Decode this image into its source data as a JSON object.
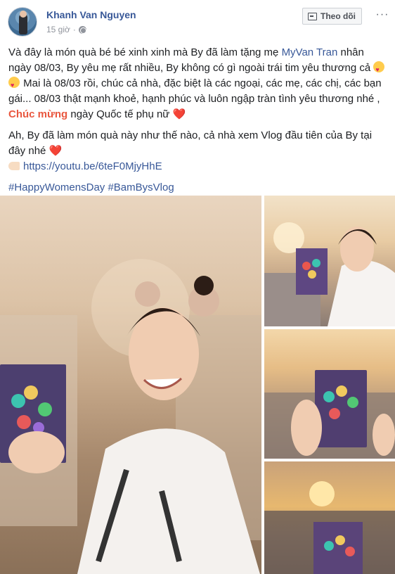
{
  "post": {
    "author": "Khanh Van Nguyen",
    "time": "15 giờ",
    "follow_label": "Theo dõi",
    "more_label": "···",
    "paragraph1": {
      "part1": "Và đây là món quà bé bé xinh xinh mà By đã làm tặng mẹ ",
      "mention": "MyVan Tran",
      "part2": " nhân ngày 08/03, By yêu mẹ rất nhiều, By không có gì ngoài trái tim yêu thương cả ",
      "part3": " Mai là 08/03 rồi, chúc cả nhà, đặc biệt là các ngoại, các mẹ, các chị, các bạn gái... 08/03 thật mạnh khoẻ, hạnh phúc và luôn ngập tràn tình yêu thương nhé , ",
      "highlight": "Chúc mừng",
      "part4": " ngày Quốc tế phụ nữ ",
      "heart": "❤️"
    },
    "paragraph2": {
      "text": "Ah, By đã làm món quà này như thế nào, cả nhà xem Vlog đầu tiên của By tại đây nhé ",
      "heart": "❤️",
      "link": "https://youtu.be/6teF0MjyHhE"
    },
    "hashtags": "#HappyWomensDay #BamBysVlog"
  },
  "photos": {
    "main_alt": "Woman holding a purple handmade card with colorful hearts",
    "thumb_count": 3
  },
  "colors": {
    "link": "#385898",
    "highlight": "#e9573f",
    "heart": "#e0245e",
    "meta": "#90949c"
  }
}
